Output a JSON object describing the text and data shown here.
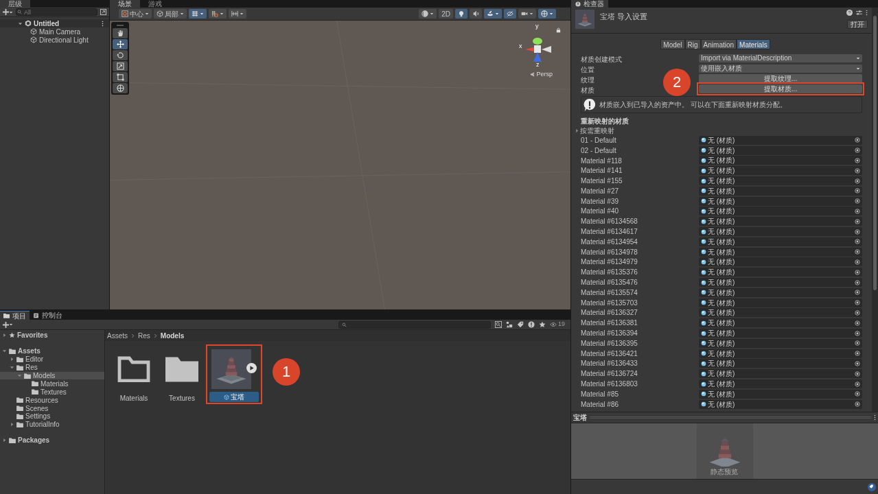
{
  "hierarchy": {
    "tab": "层级",
    "search": {
      "placeholder": "All"
    },
    "items": [
      {
        "label": "Untitled",
        "kind": "scene",
        "expanded": true,
        "children": [
          {
            "label": "Main Camera",
            "kind": "object"
          },
          {
            "label": "Directional Light",
            "kind": "object"
          }
        ]
      }
    ]
  },
  "scene": {
    "tabs": [
      {
        "label": "场景",
        "selected": true
      },
      {
        "label": "游戏",
        "selected": false
      }
    ],
    "toolbar_left": [
      {
        "label": "中心",
        "selected": false
      },
      {
        "label": "局部",
        "selected": false
      },
      {
        "selected": true
      },
      {
        "selected": false
      },
      {
        "selected": false
      }
    ],
    "toolbar_right": [
      {
        "selected": false
      },
      {
        "label": "2D",
        "selected": false
      },
      {
        "selected": true
      },
      {
        "selected": false
      },
      {
        "selected": true
      },
      {
        "selected": true
      },
      {
        "selected": false
      },
      {
        "selected": true
      }
    ],
    "tools": [
      {
        "selected": false
      },
      {
        "selected": true
      },
      {
        "selected": false
      },
      {
        "selected": false
      },
      {
        "selected": false
      },
      {
        "selected": false
      }
    ],
    "gizmo": {
      "x": "x",
      "y": "y",
      "z": "z",
      "projection": "Persp"
    }
  },
  "project": {
    "tabs": [
      {
        "label": "项目",
        "selected": true
      },
      {
        "label": "控制台",
        "selected": false
      }
    ],
    "count": "19",
    "tree": [
      {
        "label": "Favorites",
        "kind": "favorites",
        "expanded": false,
        "selected": false
      },
      {
        "label": "Assets",
        "kind": "folder",
        "expanded": true,
        "selected": false,
        "children": [
          {
            "label": "Editor",
            "kind": "folder",
            "expanded": false,
            "selected": false
          },
          {
            "label": "Res",
            "kind": "folder",
            "expanded": true,
            "selected": false,
            "children": [
              {
                "label": "Models",
                "kind": "folder",
                "expanded": true,
                "selected": true,
                "children": [
                  {
                    "label": "Materials",
                    "kind": "folder",
                    "selected": false
                  },
                  {
                    "label": "Textures",
                    "kind": "folder",
                    "selected": false
                  }
                ]
              }
            ]
          },
          {
            "label": "Resources",
            "kind": "folder",
            "selected": false
          },
          {
            "label": "Scenes",
            "kind": "folder",
            "selected": false
          },
          {
            "label": "Settings",
            "kind": "folder",
            "selected": false
          },
          {
            "label": "TutorialInfo",
            "kind": "folder",
            "expanded": false,
            "selected": false
          }
        ]
      },
      {
        "label": "Packages",
        "kind": "folder",
        "expanded": false,
        "selected": false
      }
    ],
    "breadcrumb": [
      "Assets",
      "Res",
      "Models"
    ],
    "assets": [
      {
        "name": "Materials",
        "kind": "folder",
        "empty": true,
        "selected": false
      },
      {
        "name": "Textures",
        "kind": "folder",
        "empty": false,
        "selected": false
      },
      {
        "name": "宝塔",
        "kind": "model",
        "selected": true
      }
    ]
  },
  "inspector": {
    "tab": "检查器",
    "title": "宝塔 导入设置",
    "open_button": "打开",
    "tabs": [
      {
        "label": "Model",
        "selected": false
      },
      {
        "label": "Rig",
        "selected": false
      },
      {
        "label": "Animation",
        "selected": false
      },
      {
        "label": "Materials",
        "selected": true
      }
    ],
    "fields": [
      {
        "label": "材质创建模式",
        "kind": "dropdown",
        "value": "Import via MaterialDescription"
      },
      {
        "label": "位置",
        "kind": "dropdown",
        "value": "使用嵌入材质"
      },
      {
        "label": "纹理",
        "kind": "button",
        "value": "提取纹理..."
      },
      {
        "label": "材质",
        "kind": "button",
        "value": "提取材质..."
      }
    ],
    "info": "材质嵌入到已导入的资产中。 可以在下面重新映射材质分配。",
    "section": "重新映射的材质",
    "foldout": {
      "label": "按需重映射",
      "expanded": false
    },
    "materials": [
      {
        "name": "01 - Default",
        "value": "无 (材质)"
      },
      {
        "name": "02 - Default",
        "value": "无 (材质)"
      },
      {
        "name": "Material #118",
        "value": "无 (材质)"
      },
      {
        "name": "Material #141",
        "value": "无 (材质)"
      },
      {
        "name": "Material #155",
        "value": "无 (材质)"
      },
      {
        "name": "Material #27",
        "value": "无 (材质)"
      },
      {
        "name": "Material #39",
        "value": "无 (材质)"
      },
      {
        "name": "Material #40",
        "value": "无 (材质)"
      },
      {
        "name": "Material #6134568",
        "value": "无 (材质)"
      },
      {
        "name": "Material #6134617",
        "value": "无 (材质)"
      },
      {
        "name": "Material #6134954",
        "value": "无 (材质)"
      },
      {
        "name": "Material #6134978",
        "value": "无 (材质)"
      },
      {
        "name": "Material #6134979",
        "value": "无 (材质)"
      },
      {
        "name": "Material #6135376",
        "value": "无 (材质)"
      },
      {
        "name": "Material #6135476",
        "value": "无 (材质)"
      },
      {
        "name": "Material #6135574",
        "value": "无 (材质)"
      },
      {
        "name": "Material #6135703",
        "value": "无 (材质)"
      },
      {
        "name": "Material #6136327",
        "value": "无 (材质)"
      },
      {
        "name": "Material #6136381",
        "value": "无 (材质)"
      },
      {
        "name": "Material #6136394",
        "value": "无 (材质)"
      },
      {
        "name": "Material #6136395",
        "value": "无 (材质)"
      },
      {
        "name": "Material #6136421",
        "value": "无 (材质)"
      },
      {
        "name": "Material #6136433",
        "value": "无 (材质)"
      },
      {
        "name": "Material #6136724",
        "value": "无 (材质)"
      },
      {
        "name": "Material #6136803",
        "value": "无 (材质)"
      },
      {
        "name": "Material #85",
        "value": "无 (材质)"
      },
      {
        "name": "Material #86",
        "value": "无 (材质)"
      }
    ],
    "preview": {
      "title": "宝塔",
      "caption": "静态预览"
    }
  },
  "annotations": [
    {
      "label": "1"
    },
    {
      "label": "2"
    }
  ]
}
